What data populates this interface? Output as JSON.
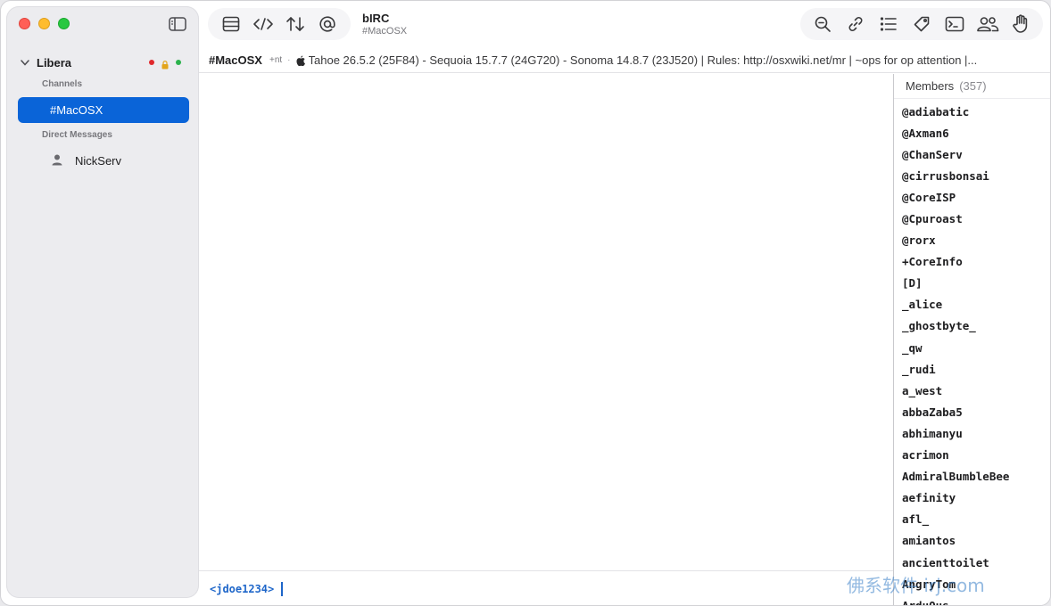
{
  "app": {
    "title": "bIRC",
    "subtitle": "#MacOSX"
  },
  "sidebar": {
    "server": {
      "name": "Libera",
      "status_colors": [
        "#e0282c",
        "#e3a41a",
        "#2bb24c"
      ]
    },
    "channels_label": "Channels",
    "channels": [
      {
        "label": "#MacOSX",
        "selected": true
      }
    ],
    "dm_label": "Direct Messages",
    "direct_messages": [
      {
        "label": "NickServ"
      }
    ]
  },
  "toolbar": {
    "left_icons": [
      "server-list-icon",
      "code-icon",
      "sort-arrows-icon",
      "mention-icon"
    ],
    "right_icons": [
      "search-icon",
      "link-icon",
      "list-icon",
      "tag-icon",
      "terminal-icon",
      "users-icon",
      "hand-icon"
    ]
  },
  "topic": {
    "channel": "#MacOSX",
    "modes": "+nt",
    "separator": "·",
    "text": "Tahoe 26.5.2 (25F84) - Sequoia 15.7.7 (24G720) - Sonoma 14.8.7 (23J520) | Rules: http://osxwiki.net/mr | ~ops for op attention |..."
  },
  "input": {
    "nick": "<jdoe1234>"
  },
  "members": {
    "title": "Members",
    "count": "(357)",
    "list": [
      "@adiabatic",
      "@Axman6",
      "@ChanServ",
      "@cirrusbonsai",
      "@CoreISP",
      "@Cpuroast",
      "@rorx",
      "+CoreInfo",
      "[D]",
      "_alice",
      "_ghostbyte_",
      "_qw",
      "_rudi",
      "a_west",
      "abbaZaba5",
      "abhimanyu",
      "acrimon",
      "AdmiralBumbleBee",
      "aefinity",
      "afl_",
      "amiantos",
      "ancienttoilet",
      "AngryTom",
      "ArduOus"
    ]
  },
  "watermark": "佛系软件 irj.com",
  "colors": {
    "accent": "#0a64d8",
    "nick": "#1e66c9"
  }
}
